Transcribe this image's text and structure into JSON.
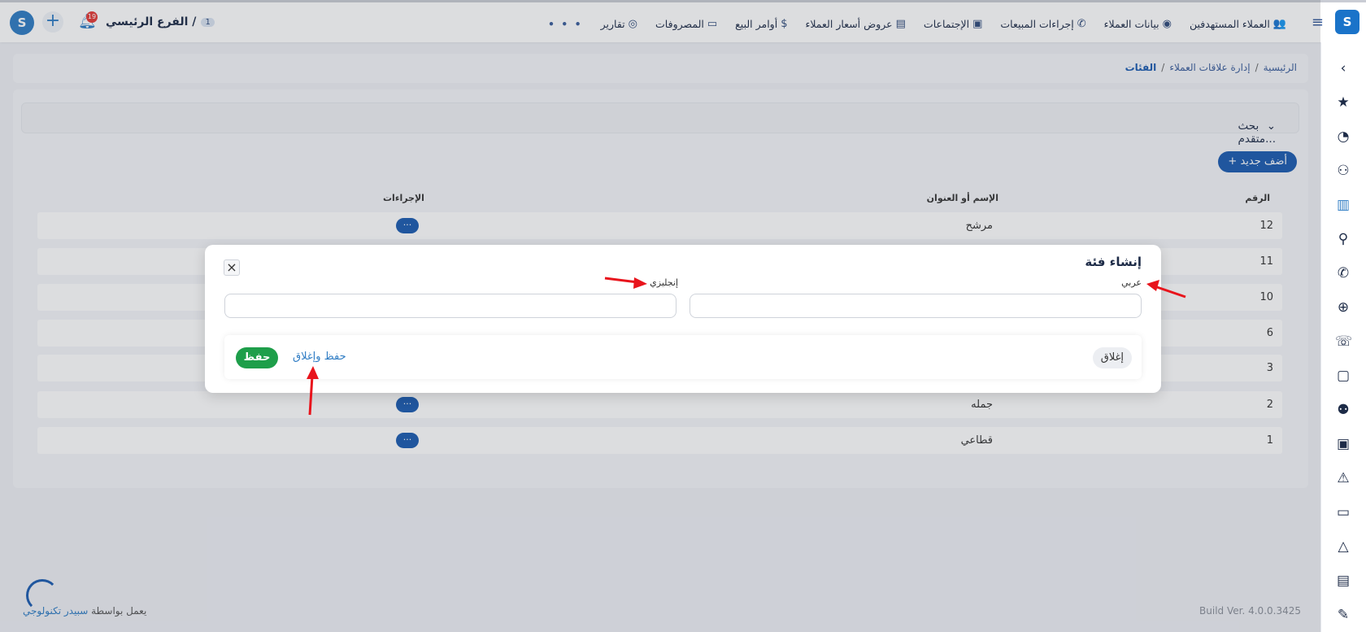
{
  "topbar": {
    "menu": [
      {
        "label": "العملاء المستهدفين",
        "icon": "target-customers-icon"
      },
      {
        "label": "بيانات العملاء",
        "icon": "customer-data-icon"
      },
      {
        "label": "إجراءات المبيعات",
        "icon": "phone-icon"
      },
      {
        "label": "الإجتماعات",
        "icon": "presentation-icon"
      },
      {
        "label": "عروض أسعار العملاء",
        "icon": "quote-icon"
      },
      {
        "label": "أوامر البيع",
        "icon": "money-bag-icon"
      },
      {
        "label": "المصروفات",
        "icon": "monitor-icon"
      },
      {
        "label": "تقارير",
        "icon": "reports-icon"
      }
    ],
    "more": "• • •",
    "branch_name": "الفرع الرئيسي /",
    "branch_num": "1",
    "notif_count": "19"
  },
  "breadcrumb": {
    "home": "الرئيسية",
    "section": "إدارة علاقات العملاء",
    "current": "الفئات",
    "sep": "/"
  },
  "search": {
    "label": "بحث متقدم..."
  },
  "add_button": "+ أضف جديد",
  "table": {
    "headers": {
      "num": "الرقم",
      "name": "الإسم أو العنوان",
      "actions": "الإجراءات"
    },
    "action_label": "···",
    "rows": [
      {
        "num": "12",
        "name": "مرشح"
      },
      {
        "num": "11",
        "name": ""
      },
      {
        "num": "10",
        "name": ""
      },
      {
        "num": "6",
        "name": ""
      },
      {
        "num": "3",
        "name": ""
      },
      {
        "num": "2",
        "name": "جمله"
      },
      {
        "num": "1",
        "name": "قطاعي"
      }
    ]
  },
  "modal": {
    "title": "إنشاء فئة",
    "close_icon": "×",
    "arabic_label": "عربي",
    "english_label": "إنجليزي",
    "arabic_value": "",
    "english_value": "",
    "close_button": "إغلاق",
    "save_close_button": "حفظ وإغلاق",
    "save_button": "حفظ"
  },
  "footer": {
    "powered_prefix": "يعمل بواسطة",
    "powered_link": "سبيدر تكنولوجي",
    "build": "Build Ver. 4.0.0.3425"
  },
  "colors": {
    "primary": "#1a5bb0",
    "save": "#1e9e4a",
    "arrow": "#e8141c"
  }
}
